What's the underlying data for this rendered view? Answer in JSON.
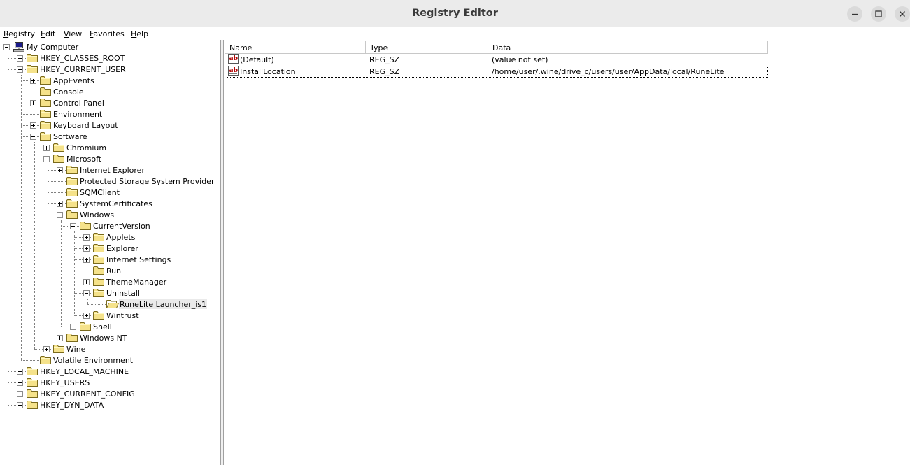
{
  "window": {
    "title": "Registry Editor",
    "controls": [
      "minimize",
      "maximize",
      "close"
    ]
  },
  "menu": [
    {
      "label": "Registry",
      "ul": "R",
      "rest": "egistry"
    },
    {
      "label": "Edit",
      "ul": "E",
      "rest": "dit"
    },
    {
      "label": "View",
      "ul": "V",
      "rest": "iew"
    },
    {
      "label": "Favorites",
      "ul": "F",
      "rest": "avorites"
    },
    {
      "label": "Help",
      "ul": "H",
      "rest": "elp"
    }
  ],
  "tree": [
    {
      "label": "My Computer",
      "level": 0,
      "expander": "minus",
      "icon": "computer-icon"
    },
    {
      "label": "HKEY_CLASSES_ROOT",
      "level": 1,
      "expander": "plus",
      "icon": "folder-icon"
    },
    {
      "label": "HKEY_CURRENT_USER",
      "level": 1,
      "expander": "minus",
      "icon": "folder-icon"
    },
    {
      "label": "AppEvents",
      "level": 2,
      "expander": "plus",
      "icon": "folder-icon"
    },
    {
      "label": "Console",
      "level": 2,
      "expander": "none",
      "icon": "folder-icon"
    },
    {
      "label": "Control Panel",
      "level": 2,
      "expander": "plus",
      "icon": "folder-icon"
    },
    {
      "label": "Environment",
      "level": 2,
      "expander": "none",
      "icon": "folder-icon"
    },
    {
      "label": "Keyboard Layout",
      "level": 2,
      "expander": "plus",
      "icon": "folder-icon"
    },
    {
      "label": "Software",
      "level": 2,
      "expander": "minus",
      "icon": "folder-icon"
    },
    {
      "label": "Chromium",
      "level": 3,
      "expander": "plus",
      "icon": "folder-icon"
    },
    {
      "label": "Microsoft",
      "level": 3,
      "expander": "minus",
      "icon": "folder-icon"
    },
    {
      "label": "Internet Explorer",
      "level": 4,
      "expander": "plus",
      "icon": "folder-icon"
    },
    {
      "label": "Protected Storage System Provider",
      "level": 4,
      "expander": "none",
      "icon": "folder-icon"
    },
    {
      "label": "SQMClient",
      "level": 4,
      "expander": "none",
      "icon": "folder-icon"
    },
    {
      "label": "SystemCertificates",
      "level": 4,
      "expander": "plus",
      "icon": "folder-icon"
    },
    {
      "label": "Windows",
      "level": 4,
      "expander": "minus",
      "icon": "folder-icon"
    },
    {
      "label": "CurrentVersion",
      "level": 5,
      "expander": "minus",
      "icon": "folder-icon"
    },
    {
      "label": "Applets",
      "level": 6,
      "expander": "plus",
      "icon": "folder-icon"
    },
    {
      "label": "Explorer",
      "level": 6,
      "expander": "plus",
      "icon": "folder-icon"
    },
    {
      "label": "Internet Settings",
      "level": 6,
      "expander": "plus",
      "icon": "folder-icon"
    },
    {
      "label": "Run",
      "level": 6,
      "expander": "none",
      "icon": "folder-icon"
    },
    {
      "label": "ThemeManager",
      "level": 6,
      "expander": "plus",
      "icon": "folder-icon"
    },
    {
      "label": "Uninstall",
      "level": 6,
      "expander": "minus",
      "icon": "folder-icon"
    },
    {
      "label": "RuneLite Launcher_is1",
      "level": 7,
      "expander": "none",
      "icon": "open-folder-icon",
      "selected": true
    },
    {
      "label": "Wintrust",
      "level": 6,
      "expander": "plus",
      "icon": "folder-icon"
    },
    {
      "label": "Shell",
      "level": 5,
      "expander": "plus",
      "icon": "folder-icon"
    },
    {
      "label": "Windows NT",
      "level": 4,
      "expander": "plus",
      "icon": "folder-icon"
    },
    {
      "label": "Wine",
      "level": 3,
      "expander": "plus",
      "icon": "folder-icon"
    },
    {
      "label": "Volatile Environment",
      "level": 2,
      "expander": "none",
      "icon": "folder-icon"
    },
    {
      "label": "HKEY_LOCAL_MACHINE",
      "level": 1,
      "expander": "plus",
      "icon": "folder-icon"
    },
    {
      "label": "HKEY_USERS",
      "level": 1,
      "expander": "plus",
      "icon": "folder-icon"
    },
    {
      "label": "HKEY_CURRENT_CONFIG",
      "level": 1,
      "expander": "plus",
      "icon": "folder-icon"
    },
    {
      "label": "HKEY_DYN_DATA",
      "level": 1,
      "expander": "plus",
      "icon": "folder-icon"
    }
  ],
  "list": {
    "columns": [
      "Name",
      "Type",
      "Data"
    ],
    "rows": [
      {
        "name": "(Default)",
        "type": "REG_SZ",
        "data": "(value not set)",
        "icon": "string-value-icon"
      },
      {
        "name": "InstallLocation",
        "type": "REG_SZ",
        "data": "/home/user/.wine/drive_c/users/user/AppData/local/RuneLite",
        "icon": "string-value-icon",
        "focused": true
      }
    ]
  }
}
